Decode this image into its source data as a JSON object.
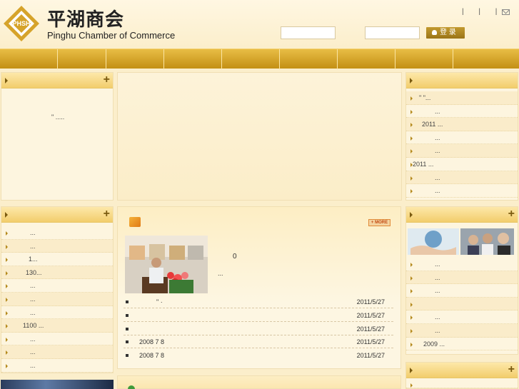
{
  "header": {
    "logo_badge_text": "PHSH",
    "title_cn": "平湖商会",
    "title_en": "Pinghu Chamber of Commerce",
    "top_links": "| | |",
    "login_label": "登 录"
  },
  "nav": {
    "items": [
      "",
      "",
      "",
      "",
      "",
      "",
      "",
      "",
      ""
    ]
  },
  "left_panel1": {
    "text": "\"    ....."
  },
  "left_panel2": {
    "items": [
      "...",
      "...",
      "1...",
      "130...",
      "...",
      "...",
      "...",
      "1100 ...",
      "...",
      "...",
      "..."
    ]
  },
  "center_news": {
    "more_label": "+ MORE",
    "feature_zero": "0",
    "feature_ellipsis": "...",
    "rows": [
      {
        "title": "\"  ·",
        "date": "2011/5/27"
      },
      {
        "title": "",
        "date": "2011/5/27"
      },
      {
        "title": "",
        "date": "2011/5/27"
      },
      {
        "title": "2008 7 8",
        "date": "2011/5/27"
      },
      {
        "title": "2008 7 8",
        "date": "2011/5/27"
      }
    ]
  },
  "right_panel1": {
    "items": [
      "\"   \"...",
      "...",
      "2011  ...",
      "...",
      "...",
      "2011      ...",
      "...",
      "..."
    ]
  },
  "right_panel2": {
    "items": [
      "...",
      "...",
      "...",
      "",
      "...",
      "...",
      "2009  ..."
    ]
  },
  "colors": {
    "nav_gold": "#d4a52a",
    "login_gold": "#a8841f",
    "more_button": "#e0893a"
  }
}
